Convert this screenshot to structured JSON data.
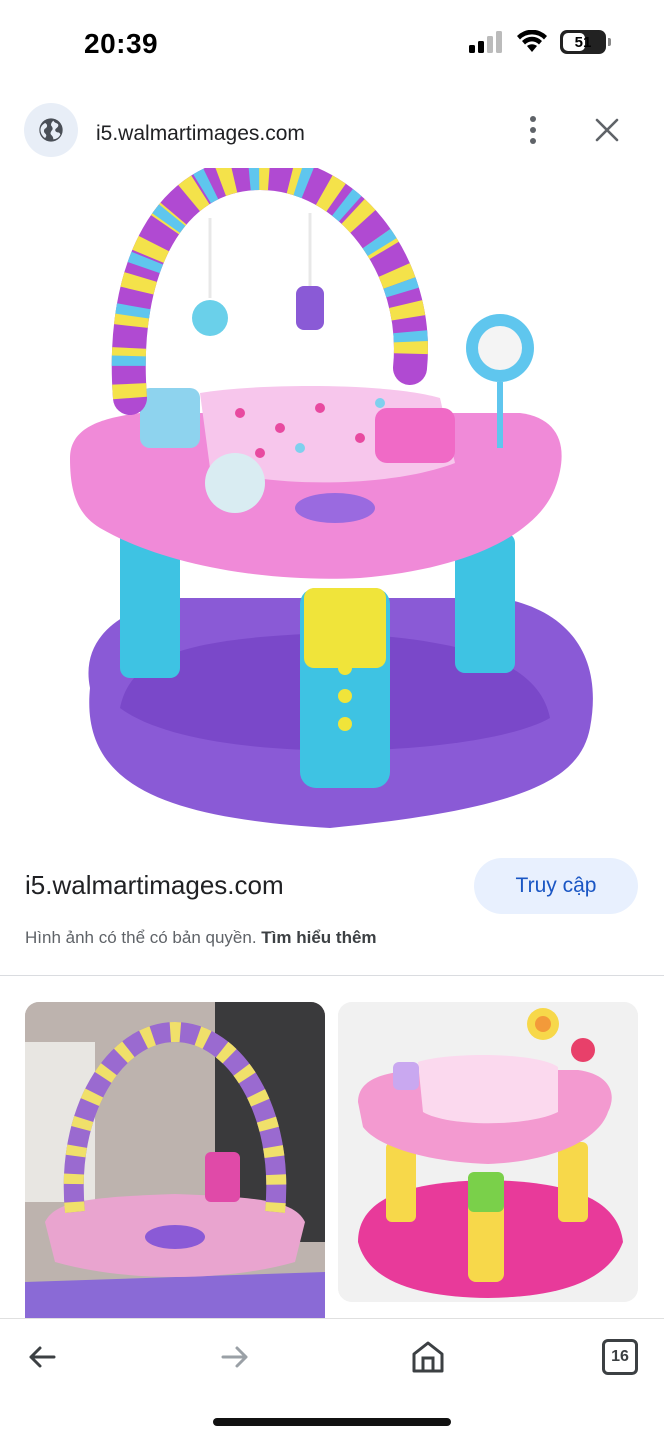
{
  "status_bar": {
    "time": "20:39",
    "battery_percent": "51",
    "battery_level": 0.51,
    "icons": [
      "cellular-signal-icon",
      "wifi-icon",
      "battery-icon"
    ]
  },
  "header": {
    "site_icon": "globe-icon",
    "url": "i5.walmartimages.com",
    "more_icon": "more-vertical-icon",
    "close_icon": "close-icon"
  },
  "image_info": {
    "domain": "i5.walmartimages.com",
    "visit_label": "Truy cập",
    "copyright_text": "Hình ảnh có thể có bản quyền.",
    "learn_more_label": "Tìm hiểu thêm"
  },
  "toolbar": {
    "back_icon": "arrow-left-icon",
    "forward_icon": "arrow-right-icon",
    "home_icon": "home-icon",
    "tabs_count": "16"
  },
  "colors": {
    "accent": "#1a56c4",
    "button_bg": "#e8f0fe",
    "secondary_text": "#5f6368"
  }
}
